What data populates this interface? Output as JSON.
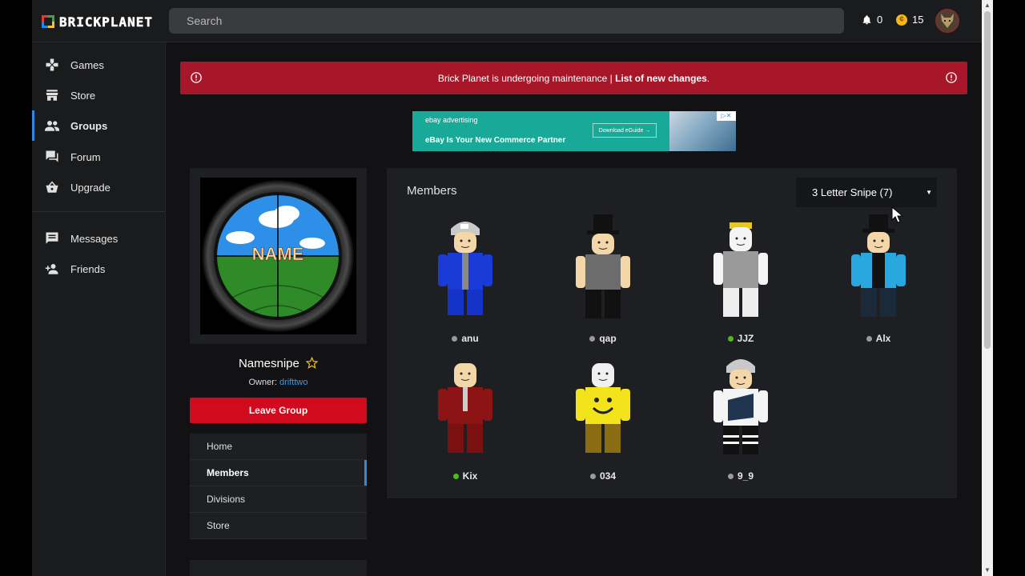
{
  "header": {
    "logo_text": "BRICKPLANET",
    "search_placeholder": "Search",
    "notification_count": "0",
    "currency_amount": "15"
  },
  "sidebar": {
    "items": [
      {
        "label": "Games",
        "icon": "gamepad-icon"
      },
      {
        "label": "Store",
        "icon": "store-icon"
      },
      {
        "label": "Groups",
        "icon": "groups-icon",
        "active": true
      },
      {
        "label": "Forum",
        "icon": "forum-icon"
      },
      {
        "label": "Upgrade",
        "icon": "basket-icon"
      },
      {
        "label": "Messages",
        "icon": "message-icon"
      },
      {
        "label": "Friends",
        "icon": "add-friend-icon"
      }
    ]
  },
  "banner": {
    "text": "Brick Planet is undergoing maintenance | ",
    "link": "List of new changes",
    "suffix": ".",
    "color": "#a8162a"
  },
  "ad": {
    "brand": "ebay advertising",
    "headline": "eBay Is Your New Commerce Partner",
    "cta": "Download eGuide →"
  },
  "group": {
    "name": "Namesnipe",
    "owner_label": "Owner:",
    "owner_name": "drifttwo",
    "image_text": "NAME",
    "leave_label": "Leave Group",
    "nav": [
      "Home",
      "Members",
      "Divisions",
      "Store"
    ],
    "active_nav": "Members"
  },
  "members": {
    "title": "Members",
    "division": "3 Letter Snipe (7)",
    "list": [
      {
        "name": "anu",
        "online": false
      },
      {
        "name": "qap",
        "online": false
      },
      {
        "name": "JJZ",
        "online": true
      },
      {
        "name": "Alx",
        "online": false
      },
      {
        "name": "Kix",
        "online": true
      },
      {
        "name": "034",
        "online": false
      },
      {
        "name": "9_9",
        "online": false
      }
    ]
  },
  "colors": {
    "accent": "#2d8ae0",
    "danger": "#d10a1e",
    "online": "#4cbb17",
    "offline": "#9a9a9a"
  }
}
